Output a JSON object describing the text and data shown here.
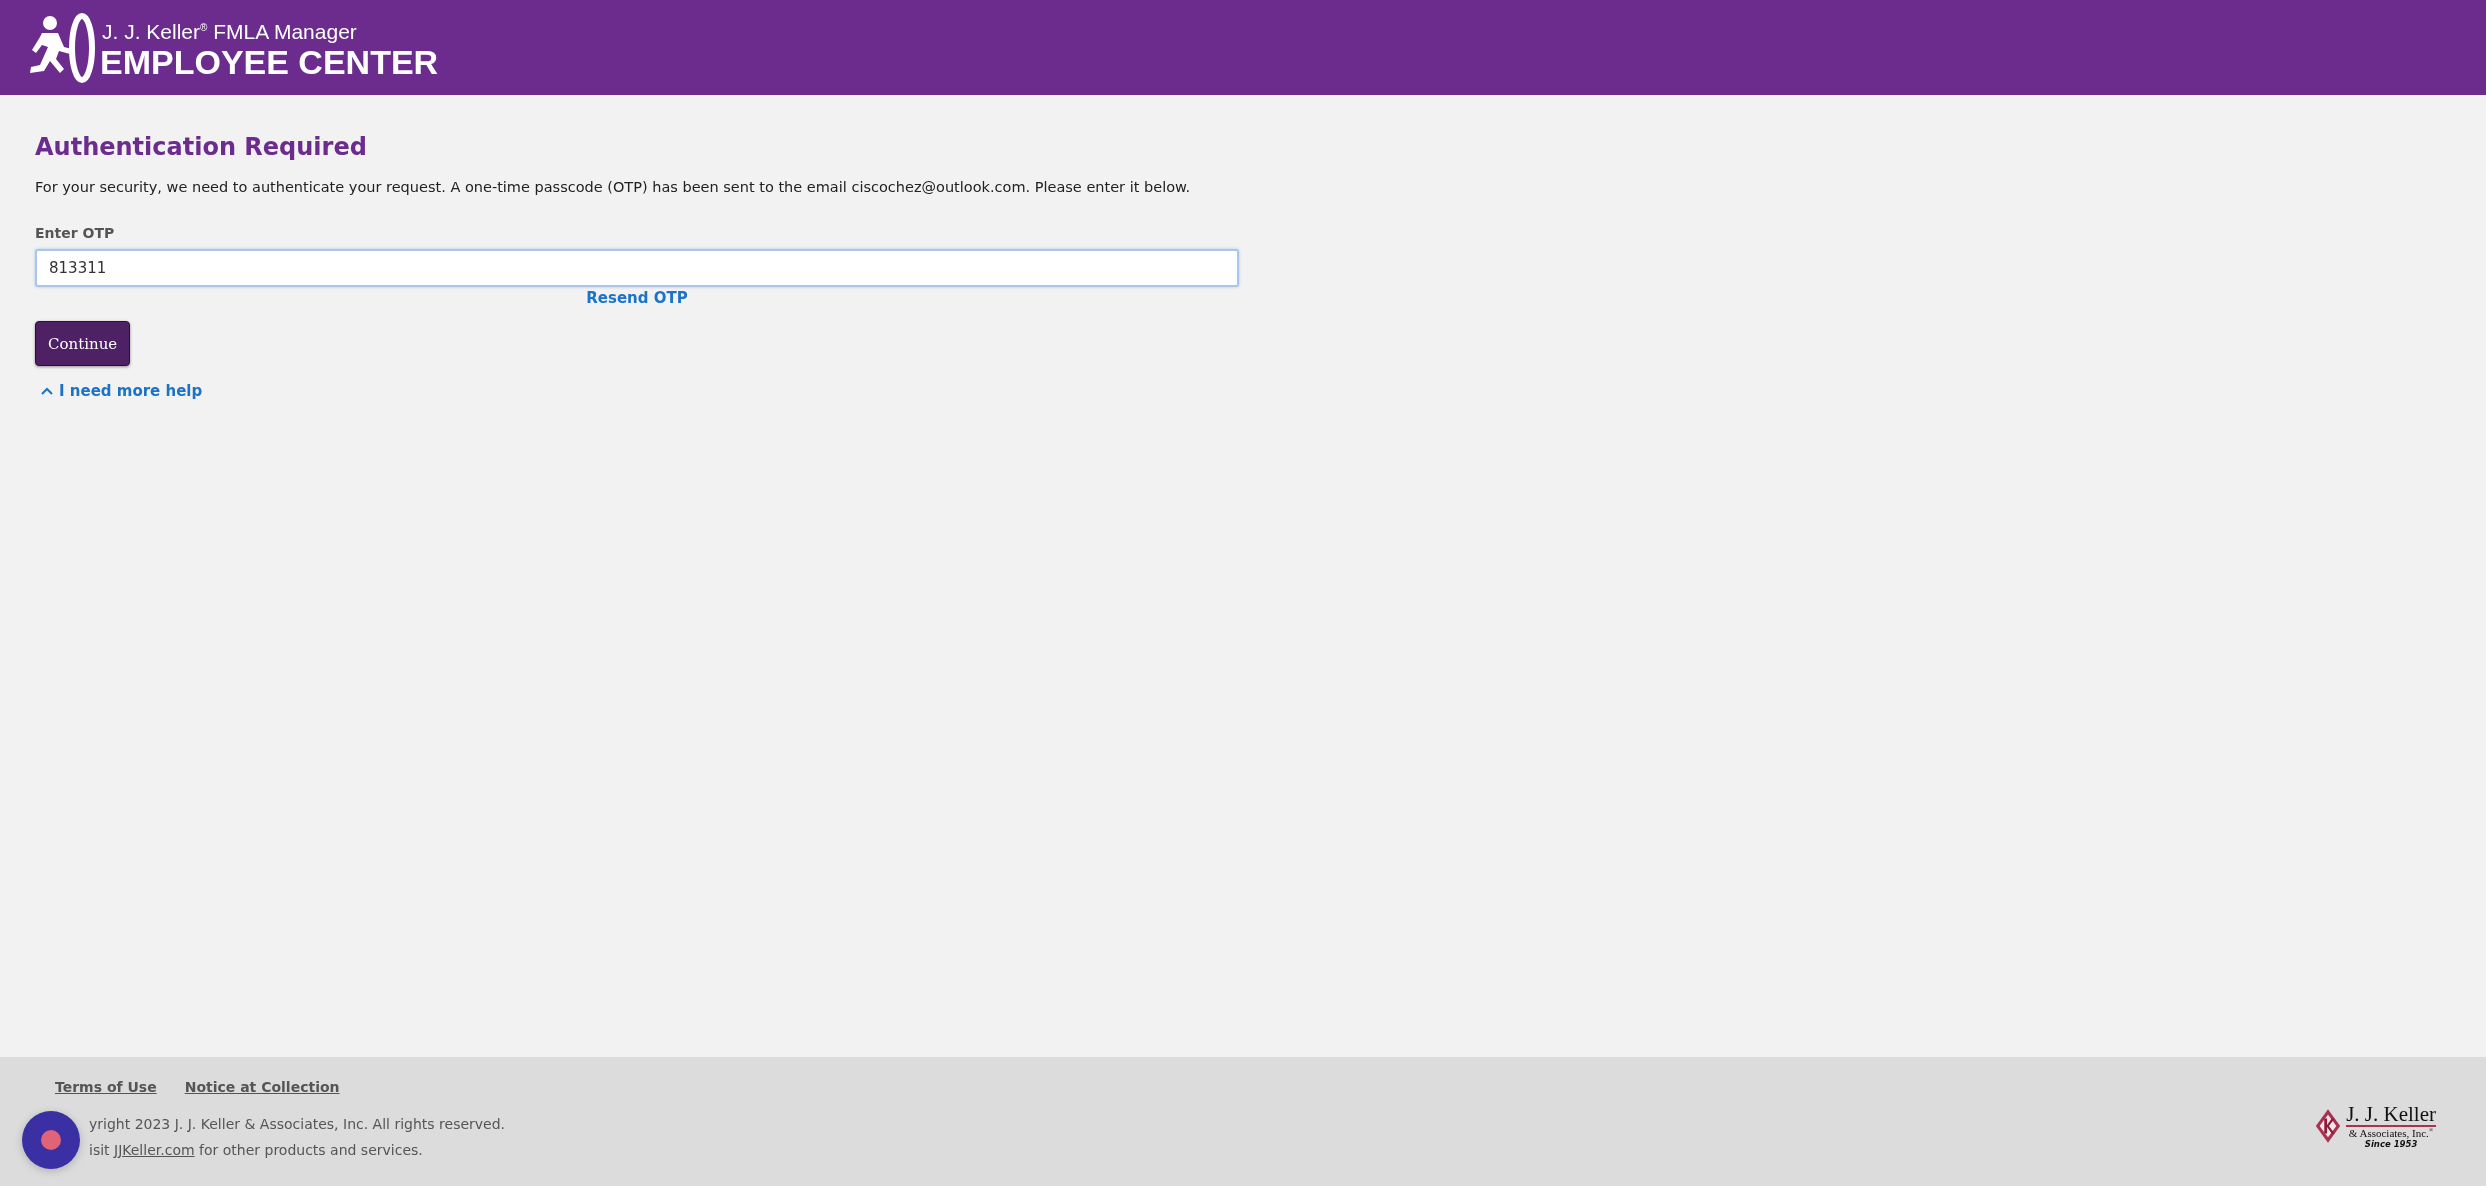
{
  "header": {
    "brand_line": "J. J. Keller$^{®}$ FMLA Manager",
    "product": "EMPLOYEE CENTER"
  },
  "main": {
    "heading": "Authentication Required",
    "message": "For your security, we need to authenticate your request. A one-time passcode (OTP) has been sent to the email ciscochez@outlook.com. Please enter it below.",
    "otp_label": "Enter OTP",
    "otp_value": "813311",
    "otp_focused": true,
    "resend_link": "Resend OTP",
    "continue_button": "Continue",
    "help_toggle": {
      "label": "I need more help",
      "expanded": false
    }
  },
  "footer": {
    "links": [
      "Terms of Use",
      "Notice at Collection"
    ],
    "copyright": "yright 2023 J. J. Keller & Associates, Inc. All rights reserved.",
    "visit_prefix": "isit",
    "visit_link": "JJKeller.com",
    "visit_suffix": "for other products and services.",
    "logo": {
      "name": "J. J. Keller",
      "subtitle": "& Associates, Inc.$^{®}$",
      "tagline": "Since 1953"
    }
  }
}
